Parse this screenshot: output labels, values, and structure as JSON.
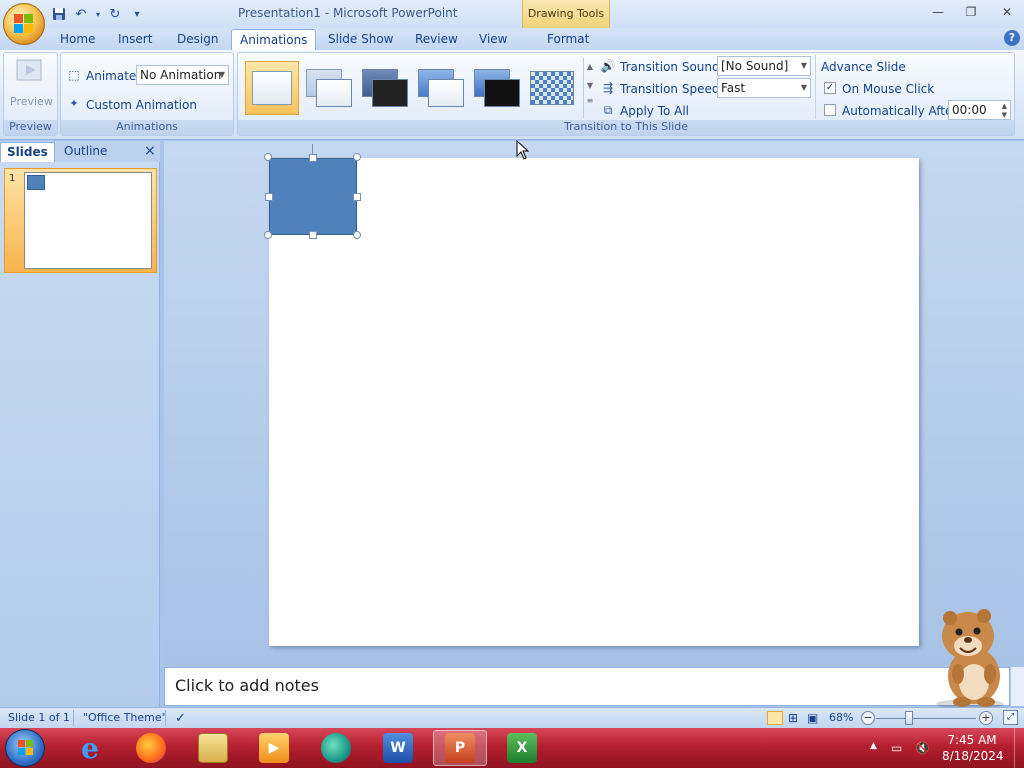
{
  "window": {
    "title": "Presentation1 - Microsoft PowerPoint",
    "context_tab_group": "Drawing Tools",
    "controls": {
      "minimize": "—",
      "restore": "❐",
      "close": "✕"
    }
  },
  "quick_access": {
    "save_icon": "save-icon",
    "undo_icon": "undo-icon",
    "redo_icon": "redo-icon",
    "customize_icon": "customize-icon"
  },
  "tabs": [
    {
      "label": "Home",
      "active": false
    },
    {
      "label": "Insert",
      "active": false
    },
    {
      "label": "Design",
      "active": false
    },
    {
      "label": "Animations",
      "active": true
    },
    {
      "label": "Slide Show",
      "active": false
    },
    {
      "label": "Review",
      "active": false
    },
    {
      "label": "View",
      "active": false
    },
    {
      "label": "Format",
      "active": false
    }
  ],
  "ribbon": {
    "preview": {
      "button_label": "Preview",
      "group_label": "Preview"
    },
    "animations": {
      "animate_label": "Animate:",
      "animate_value": "No Animation",
      "custom_animation_label": "Custom Animation",
      "group_label": "Animations"
    },
    "transitions": {
      "group_label": "Transition to This Slide",
      "sound_label": "Transition Sound:",
      "sound_value": "[No Sound]",
      "speed_label": "Transition Speed:",
      "speed_value": "Fast",
      "apply_all_label": "Apply To All"
    },
    "advance": {
      "title": "Advance Slide",
      "on_mouse_click_label": "On Mouse Click",
      "on_mouse_click_checked": true,
      "auto_after_label": "Automatically After:",
      "auto_after_checked": false,
      "auto_after_value": "00:00"
    }
  },
  "left_pane": {
    "tab_slides": "Slides",
    "tab_outline": "Outline",
    "close": "×",
    "slide_number": "1"
  },
  "notes": {
    "placeholder": "Click to add notes"
  },
  "status": {
    "slide_info": "Slide 1 of 1",
    "theme": "\"Office Theme\"",
    "zoom": "68%",
    "zoom_minus": "−",
    "zoom_plus": "+"
  },
  "taskbar": {
    "apps": [
      "internet-explorer",
      "firefox",
      "file-explorer",
      "media-player",
      "browser",
      "word",
      "powerpoint",
      "excel"
    ],
    "active_app": "powerpoint",
    "time": "7:45 AM",
    "date": "8/18/2024"
  },
  "colors": {
    "shape_fill": "#4f81bd",
    "accent": "#15428b"
  }
}
